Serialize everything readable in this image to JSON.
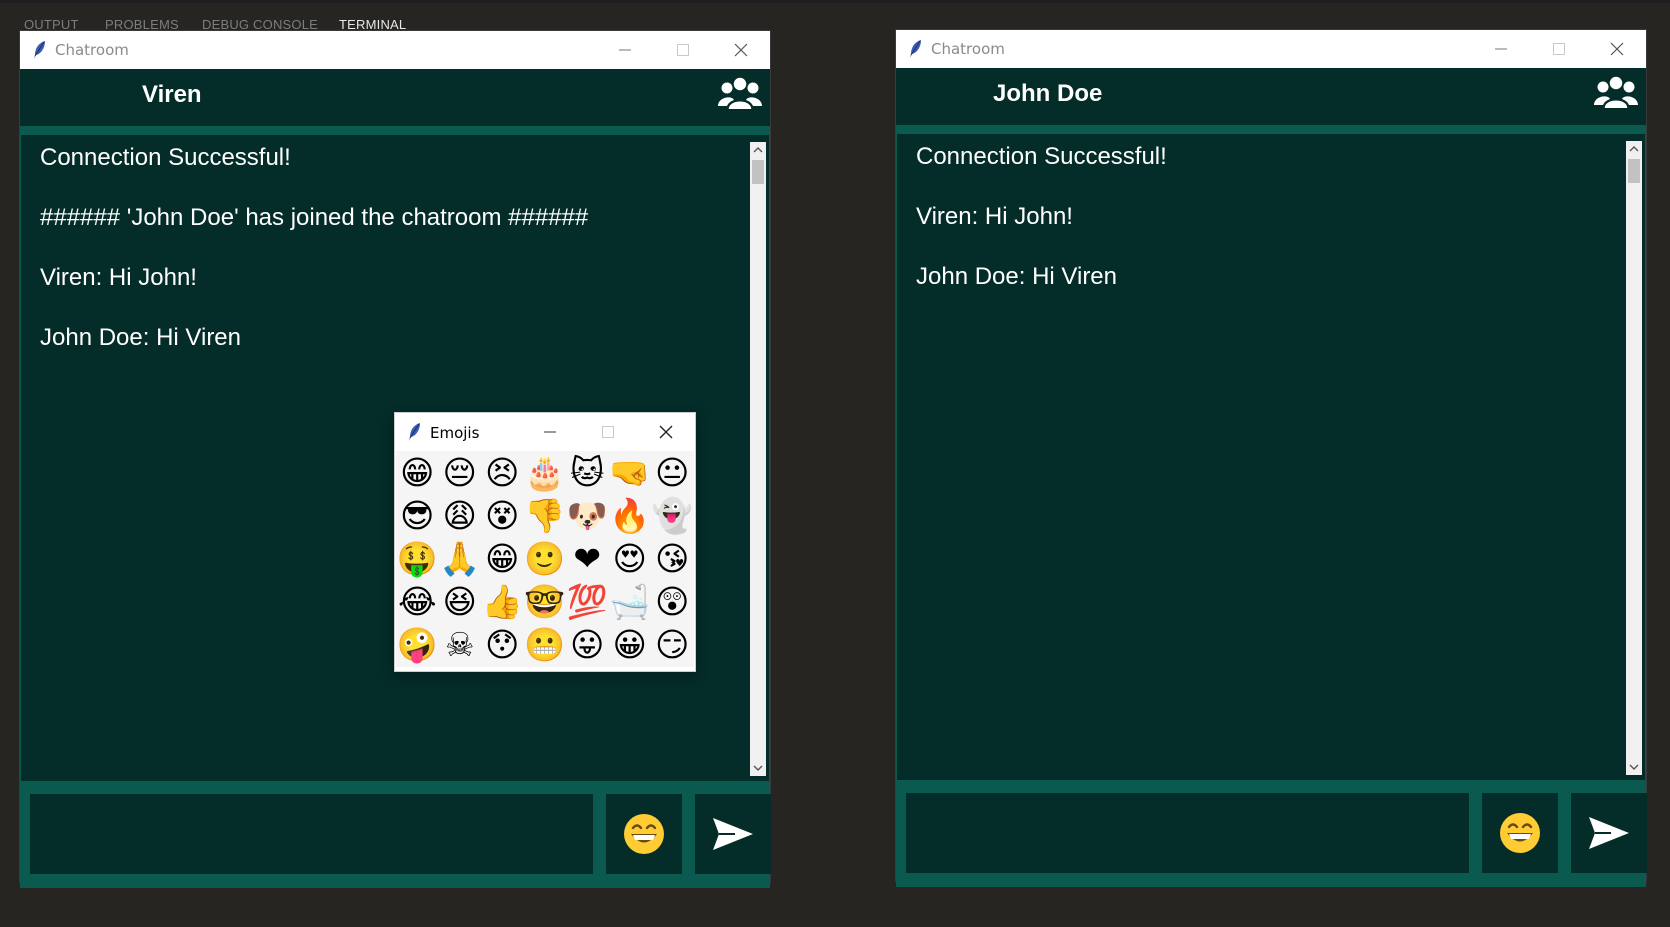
{
  "panel": {
    "tabs": [
      "OUTPUT",
      "PROBLEMS",
      "DEBUG CONSOLE",
      "TERMINAL"
    ]
  },
  "windows": [
    {
      "title": "Chatroom",
      "user": "Viren",
      "messages": [
        "Connection Successful!",
        "###### 'John Doe' has joined the chatroom ######",
        "Viren: Hi John!",
        "John Doe: Hi Viren"
      ],
      "input_value": ""
    },
    {
      "title": "Chatroom",
      "user": "John Doe",
      "messages": [
        "Connection Successful!",
        "Viren: Hi John!",
        "John Doe: Hi Viren"
      ],
      "input_value": ""
    }
  ],
  "emoji_popup": {
    "title": "Emojis",
    "emojis": [
      "😁",
      "😔",
      "😣",
      "🎂",
      "🐱",
      "🤜",
      "😐",
      "😎",
      "😩",
      "😵",
      "👎",
      "🐶",
      "🔥",
      "👻",
      "🤑",
      "🙏",
      "😁",
      "🙂",
      "❤",
      "😍",
      "😘",
      "😂",
      "😆",
      "👍",
      "🤓",
      "💯",
      "🛁",
      "😲",
      "🤪",
      "☠",
      "😯",
      "😬",
      "😛",
      "😀",
      "😏"
    ]
  },
  "icons": {
    "app": "feather-icon",
    "users": "users-icon",
    "emoji_button": "grin-emoji-icon",
    "send": "send-arrow-icon"
  },
  "colors": {
    "dark_bg": "#042c28",
    "accent_teal": "#0b5a4f",
    "outer_bg": "#262521"
  }
}
